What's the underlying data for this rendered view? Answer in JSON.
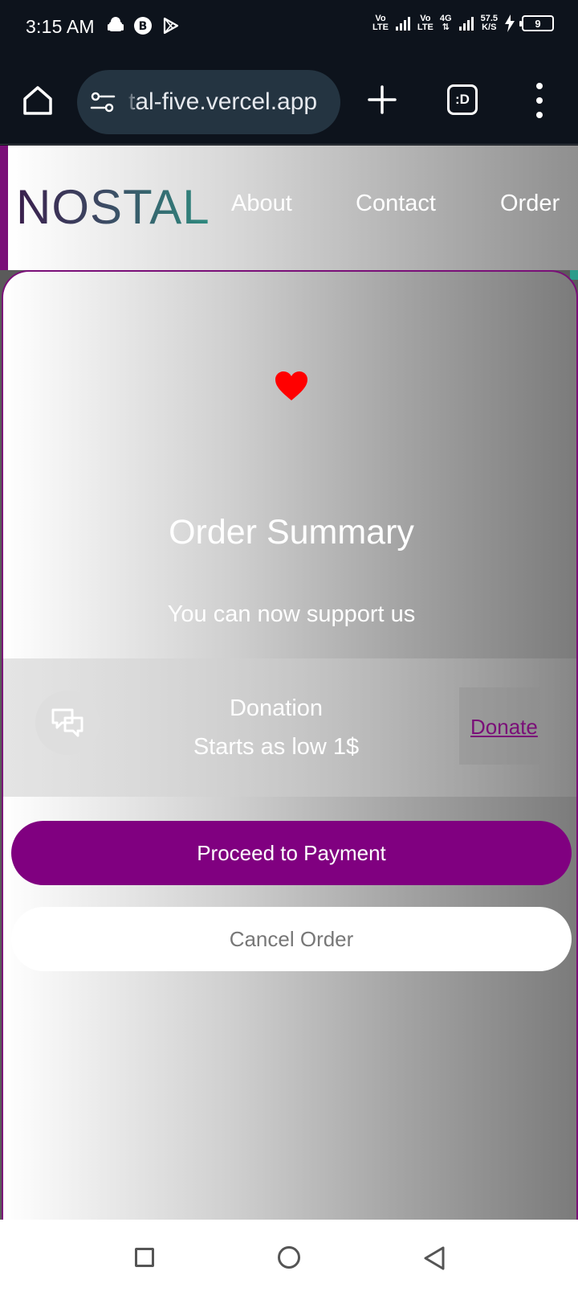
{
  "status_bar": {
    "time": "3:15 AM",
    "net1_top": "Vo",
    "net1_bottom": "LTE",
    "net2_top": "Vo",
    "net2_bottom": "LTE",
    "net3_top": "4G",
    "speed_value": "57.5",
    "speed_unit": "K/S",
    "battery_level": "9"
  },
  "browser": {
    "url": "tal-five.vercel.app",
    "tabs_label": ":D"
  },
  "site": {
    "logo": "NOSTAL",
    "nav": {
      "about": "About",
      "contact": "Contact",
      "order": "Order"
    }
  },
  "order": {
    "title": "Order Summary",
    "subtitle": "You can now support us",
    "donation_title": "Donation",
    "donation_price": "Starts as low 1$",
    "donate_label": "Donate",
    "proceed_label": "Proceed to Payment",
    "cancel_label": "Cancel Order"
  },
  "colors": {
    "brand_purple": "#800080",
    "heart_red": "#ff0000",
    "teal_accent": "#2e8b7f"
  },
  "icons": {
    "home": "home-icon",
    "site_settings": "tune-icon",
    "new_tab": "plus-icon",
    "tab_switcher": "tabs-icon",
    "more": "more-vert-icon",
    "favorite": "heart-icon",
    "chat": "chat-bubbles-icon"
  }
}
